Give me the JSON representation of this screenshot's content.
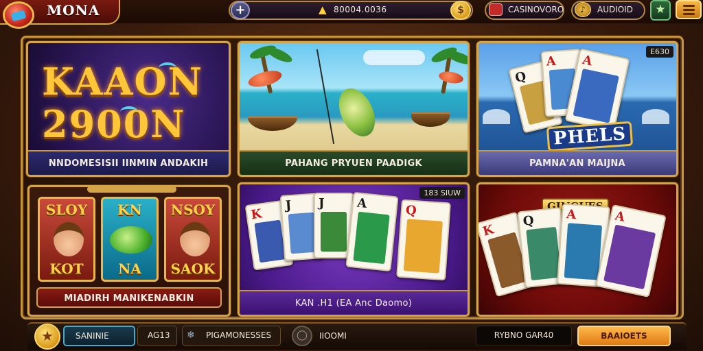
{
  "header": {
    "logo_text": "MONA",
    "add_button": "+",
    "coin_value": "80004.0036",
    "casino_label": "CASINOVORO",
    "audio_label": "AUDIOID"
  },
  "tiles": [
    {
      "title_line1": "KAAON",
      "title_line2": "2900N",
      "label": "NNDOMESISII IINMIN ANDAKIH"
    },
    {
      "label": "PAHANG PRYUEN PAADIGK"
    },
    {
      "badge": "E630",
      "logo": "PHELS",
      "label": "PAMNA'AN MAIJNA"
    },
    {
      "reels": [
        {
          "top": "SLOY",
          "bottom": "KOT"
        },
        {
          "top": "KN",
          "bottom": "NA"
        },
        {
          "top": "NSOY",
          "bottom": "SAOK"
        }
      ],
      "label": "MIADIRH MANIKENABKIN"
    },
    {
      "badge": "183 SIUW",
      "label": "KAN .H1 (EA Anc Daomo)"
    },
    {
      "sign": "GINGUES"
    }
  ],
  "footer": {
    "name_field": "SANINIE",
    "number_field": "AG13",
    "promo_field": "PIGAMONESSES",
    "room_label": "IIOOMI",
    "dark_button": "RYBNO GAR40",
    "orange_button": "BAAIOETS"
  },
  "colors": {
    "gold": "#d6a448",
    "accent_orange": "#e07a14",
    "background": "#3a1c0c"
  }
}
